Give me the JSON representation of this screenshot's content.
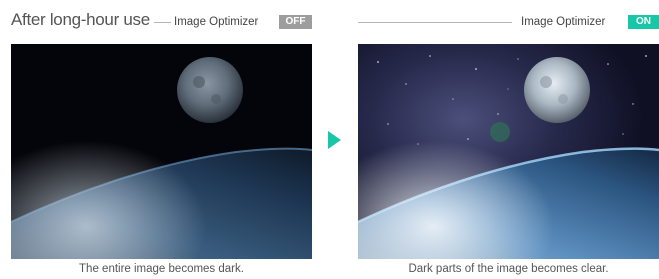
{
  "left": {
    "title": "After long-hour use",
    "optimizer_label": "Image Optimizer",
    "status": "OFF",
    "caption": "The entire image becomes dark."
  },
  "right": {
    "optimizer_label": "Image Optimizer",
    "status": "ON",
    "caption": "Dark parts of the image becomes clear."
  },
  "colors": {
    "accent": "#18c7a8",
    "off_badge": "#9d9d9d",
    "text": "#555555"
  },
  "icons": {
    "arrow": "play-triangle-icon"
  }
}
